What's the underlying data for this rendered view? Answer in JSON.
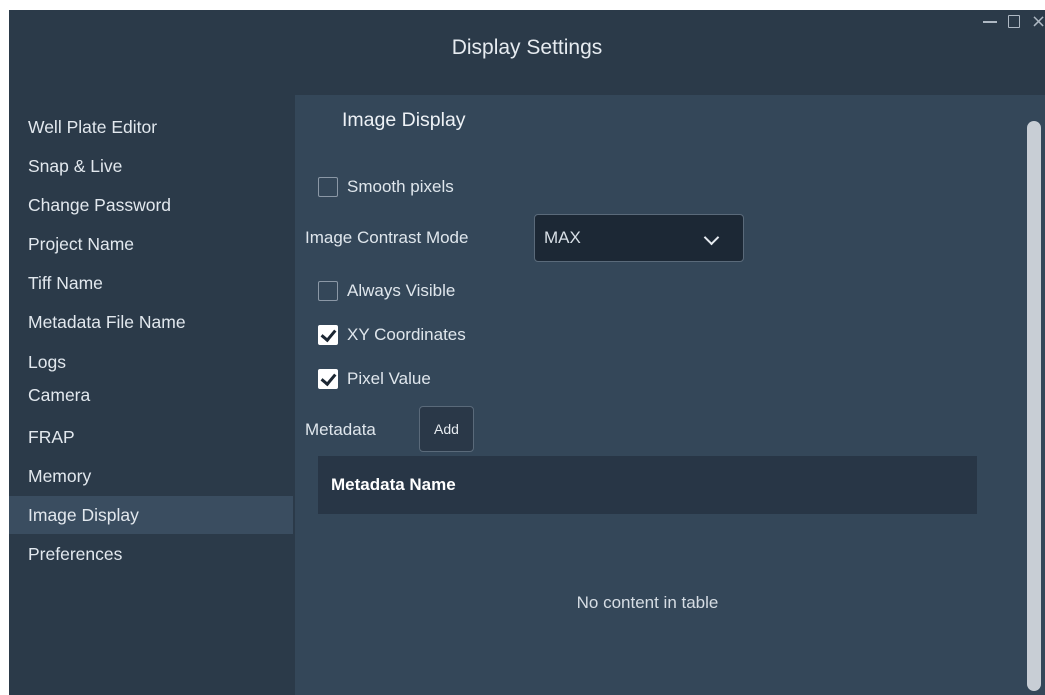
{
  "window": {
    "title": "Display Settings",
    "controls": {
      "minimize_icon": "minimize-icon",
      "maximize_icon": "maximize-icon",
      "close_icon": "close-icon",
      "close_glyph": "×"
    }
  },
  "sidebar": {
    "items": [
      {
        "label": "Well Plate Editor"
      },
      {
        "label": "Snap & Live"
      },
      {
        "label": "Change Password"
      },
      {
        "label": "Project Name"
      },
      {
        "label": "Tiff Name"
      },
      {
        "label": "Metadata File Name"
      },
      {
        "label": "Logs"
      },
      {
        "label": "Camera"
      },
      {
        "label": "FRAP"
      },
      {
        "label": "Memory"
      },
      {
        "label": "Image Display",
        "selected": true
      },
      {
        "label": "Preferences"
      }
    ]
  },
  "content": {
    "section_title": "Image Display",
    "smooth_pixels": {
      "label": "Smooth pixels",
      "checked": false
    },
    "contrast_mode": {
      "label": "Image Contrast Mode",
      "value": "MAX"
    },
    "always_visible": {
      "label": "Always Visible",
      "checked": false
    },
    "xy_coordinates": {
      "label": "XY Coordinates",
      "checked": true
    },
    "pixel_value": {
      "label": "Pixel Value",
      "checked": true
    },
    "metadata": {
      "label": "Metadata",
      "add_label": "Add",
      "table": {
        "columns": [
          "Metadata Name"
        ],
        "rows": [],
        "empty_message": "No content in table"
      }
    }
  },
  "colors": {
    "window_bg": "#2b3a49",
    "content_bg": "#344759",
    "selected_bg": "#3a4d60",
    "table_header_bg": "#283646"
  }
}
